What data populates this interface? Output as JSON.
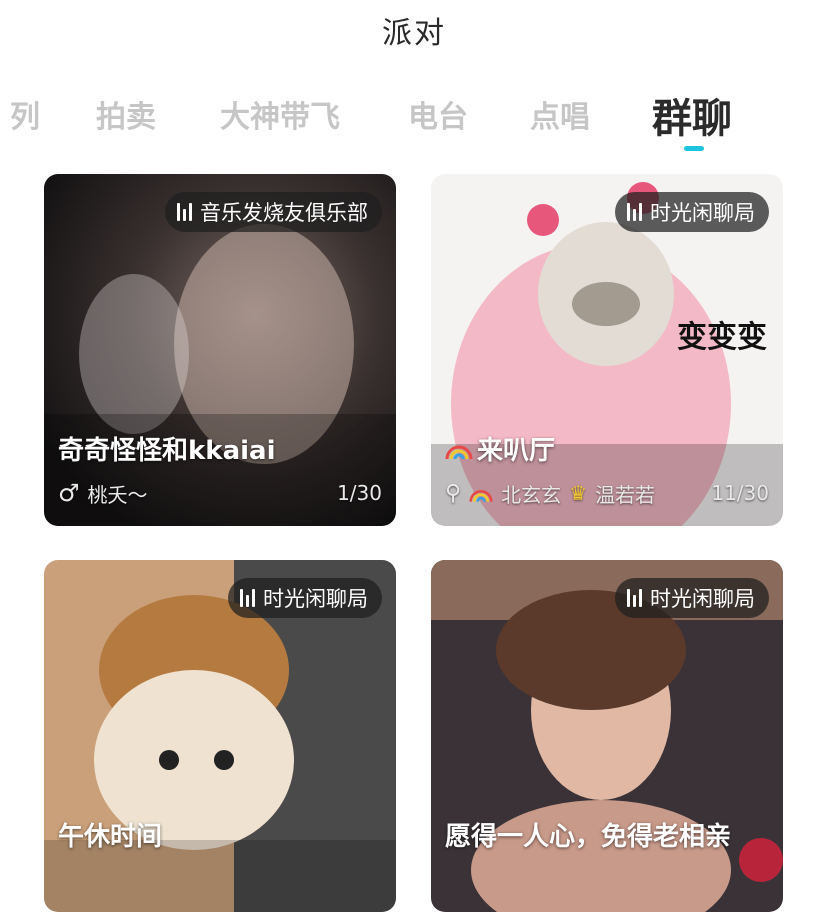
{
  "header": {
    "title": "派对"
  },
  "tabs": [
    {
      "label": "列"
    },
    {
      "label": "拍卖"
    },
    {
      "label": "大神带飞"
    },
    {
      "label": "电台"
    },
    {
      "label": "点唱"
    },
    {
      "label": "群聊",
      "active": true
    }
  ],
  "cards": [
    {
      "tag": "音乐发烧友俱乐部",
      "title": "奇奇怪怪和kkaiai",
      "host": "桃夭～",
      "host_icon": "male-icon",
      "count": "1/30"
    },
    {
      "tag": "时光闲聊局",
      "title": "来叭厅",
      "sticker_text": "变变变",
      "host_a": "北玄玄",
      "host_b": "温若若",
      "host_icon": "search-icon",
      "count": "11/30"
    },
    {
      "tag": "时光闲聊局",
      "title": "午休时间"
    },
    {
      "tag": "时光闲聊局",
      "title": "愿得一人心，免得老相亲"
    }
  ],
  "colors": {
    "accent": "#1ec3e0",
    "active_tab": "#2b2b2b",
    "inactive_tab": "#c6c6c6"
  }
}
